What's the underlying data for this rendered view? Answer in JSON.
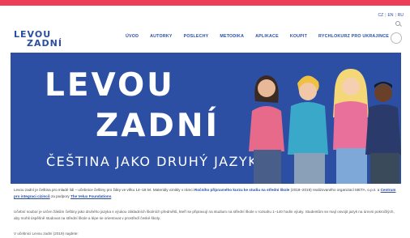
{
  "colors": {
    "accent": "#ee3d57",
    "brand": "#2a4fa0",
    "hero_bg": "#2d4fa3"
  },
  "lang": {
    "cz": "CZ",
    "en": "EN",
    "ru": "RU"
  },
  "logo": {
    "line1": "LEVOU",
    "line2": "ZADNÍ"
  },
  "nav": [
    "ÚVOD",
    "AUTORKY",
    "POSLECHY",
    "METODIKA",
    "APLIKACE",
    "KOUPIT",
    "RYCHLOKURZ PRO UKRAJINCE"
  ],
  "hero": {
    "title_line1": "LEVOU",
    "title_line2": "ZADNÍ",
    "tagline": "ČEŠTINA JAKO DRUHÝ JAZYK"
  },
  "intro": {
    "text_a": "Levou zadní je čeština pro mladé lidi – učebnice češtiny pro žáky ve věku 14–18 let. Materiály vznikly v rámci ",
    "bold_a": "Ročního přípravného kurzu ke studiu na střední škole",
    "text_b": " (2018–2019) realizovaného organizací META, o.p.s. a ",
    "link_a": "Centrum pro integraci cizinců",
    "text_c": " za podpory ",
    "link_b": "The Velux Foundations",
    "text_d": "."
  },
  "para2": "Učební soubor je určen žákům češtiny jako druhého jazyka s výukou základních školních předmětů, kteří se připravují na studium na střední škole v rozsahu 1–140 hodin výuky. Studentům se mají osvojit jazyk na úrovni pokročilých, aby mohli úspěšně studovat na střední škole a lépe se orientovat v prostředí české školy.",
  "para3": "V učebnici Levou zadní (2019) najdete:"
}
